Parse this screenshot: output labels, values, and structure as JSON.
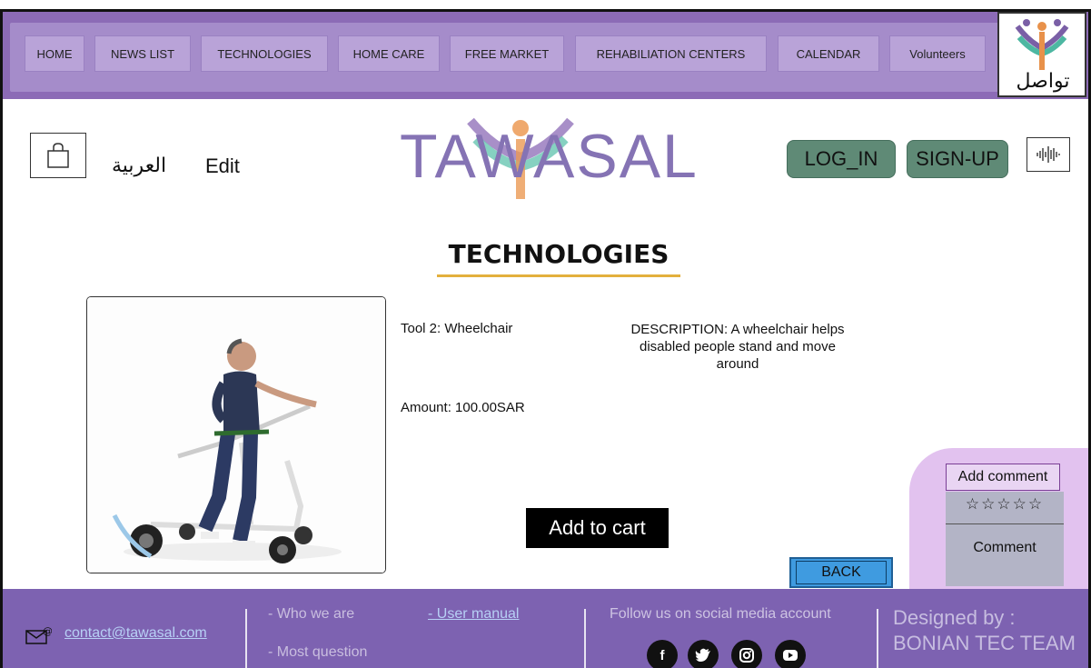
{
  "nav": {
    "items": [
      "HOME",
      "NEWS LIST",
      "TECHNOLOGIES",
      "HOME CARE",
      "FREE MARKET",
      "REHABILIATION CENTERS",
      "CALENDAR",
      "Volunteers"
    ],
    "logo_text": "تواصل"
  },
  "header": {
    "language": "العربية",
    "edit": "Edit",
    "brand": "TAWASAL",
    "login": "LOG_IN",
    "signup": "SIGN-UP"
  },
  "page": {
    "title": "TECHNOLOGIES"
  },
  "product": {
    "name": "Tool 2: Wheelchair",
    "amount": "Amount: 100.00SAR",
    "description": "DESCRIPTION: A wheelchair helps disabled people stand and move around",
    "add_to_cart": "Add to cart",
    "back": "BACK"
  },
  "comments": {
    "add_label": "Add comment",
    "stars": "☆☆☆☆☆",
    "rating": 0,
    "comment_label": "Comment"
  },
  "footer": {
    "email": "contact@tawasal.com",
    "who_we_are": "- Who we are",
    "most_question": "- Most question",
    "user_manual": "- User manual",
    "follow": "Follow us on social media account",
    "social": [
      "facebook-icon",
      "twitter-icon",
      "instagram-icon",
      "youtube-icon"
    ],
    "designed_by": "Designed by :",
    "team": "BONIAN TEC TEAM"
  },
  "colors": {
    "nav_bg": "#8c6bb6",
    "footer_bg": "#7d62b1",
    "auth_btn": "#5f8a76",
    "back_btn": "#3f9be0",
    "comment_panel": "#e2c2ef",
    "title_underline": "#e3b03d"
  }
}
